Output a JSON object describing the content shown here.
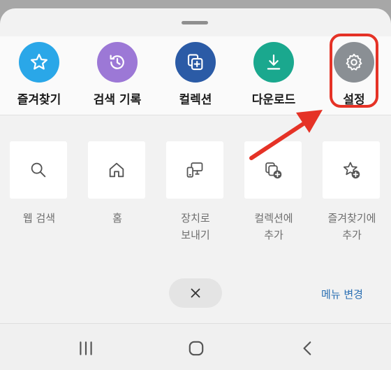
{
  "top_actions": [
    {
      "id": "favorites",
      "label": "즐겨찾기",
      "color": "#2aa7e8",
      "icon": "star-icon"
    },
    {
      "id": "history",
      "label": "검색 기록",
      "color": "#9c78d6",
      "icon": "history-icon"
    },
    {
      "id": "collections",
      "label": "컬렉션",
      "color": "#2b5ba6",
      "icon": "collection-add-icon"
    },
    {
      "id": "downloads",
      "label": "다운로드",
      "color": "#1aa88e",
      "icon": "download-icon"
    },
    {
      "id": "settings",
      "label": "설정",
      "color": "#8a8f94",
      "icon": "gear-icon"
    }
  ],
  "tiles": [
    {
      "id": "web-search",
      "label": "웹 검색",
      "icon": "search-icon"
    },
    {
      "id": "home",
      "label": "홈",
      "icon": "home-icon"
    },
    {
      "id": "send-to-device",
      "label": "장치로\n보내기",
      "icon": "devices-icon"
    },
    {
      "id": "add-to-collection",
      "label": "컬렉션에\n추가",
      "icon": "collection-add-icon"
    },
    {
      "id": "add-to-favorites",
      "label": "즐겨찾기에\n추가",
      "icon": "star-add-icon"
    }
  ],
  "bottom": {
    "edit_menu_label": "메뉴 변경",
    "close_icon": "close-icon"
  },
  "annotation": {
    "highlight_color": "#e53226",
    "arrow_color": "#e53226"
  },
  "navigation_bar": {
    "buttons": [
      "recent-apps-icon",
      "home-nav-icon",
      "back-icon"
    ]
  }
}
